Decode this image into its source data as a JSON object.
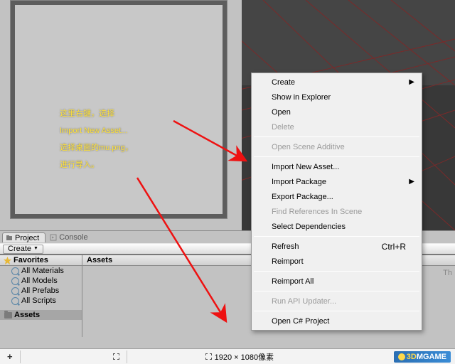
{
  "tabs": {
    "project": "Project",
    "console": "Console"
  },
  "create_btn": "Create",
  "favorites": {
    "header": "Favorites",
    "items": [
      "All Materials",
      "All Models",
      "All Prefabs",
      "All Scripts"
    ]
  },
  "assets_label": "Assets",
  "breadcrumb": "Assets",
  "statusbar": {
    "dims": "1920 × 1080像素",
    "plus": "+"
  },
  "logo": {
    "brand_d": "3D",
    "brand_rest": "MGAME"
  },
  "annotation": {
    "l1": "这里右键，选择",
    "l2": "Import New Asset...",
    "l3": "选择桌面的mu.png，",
    "l4": "进行导入。"
  },
  "menu": {
    "create": "Create",
    "show": "Show in Explorer",
    "open": "Open",
    "delete": "Delete",
    "openscene": "Open Scene Additive",
    "import": "Import New Asset...",
    "importpkg": "Import Package",
    "exportpkg": "Export Package...",
    "findrefs": "Find References In Scene",
    "seldep": "Select Dependencies",
    "refresh": "Refresh",
    "refresh_kb": "Ctrl+R",
    "reimport": "Reimport",
    "reimportall": "Reimport All",
    "apiupd": "Run API Updater...",
    "opencsharp": "Open C# Project"
  },
  "right_text": "Th"
}
